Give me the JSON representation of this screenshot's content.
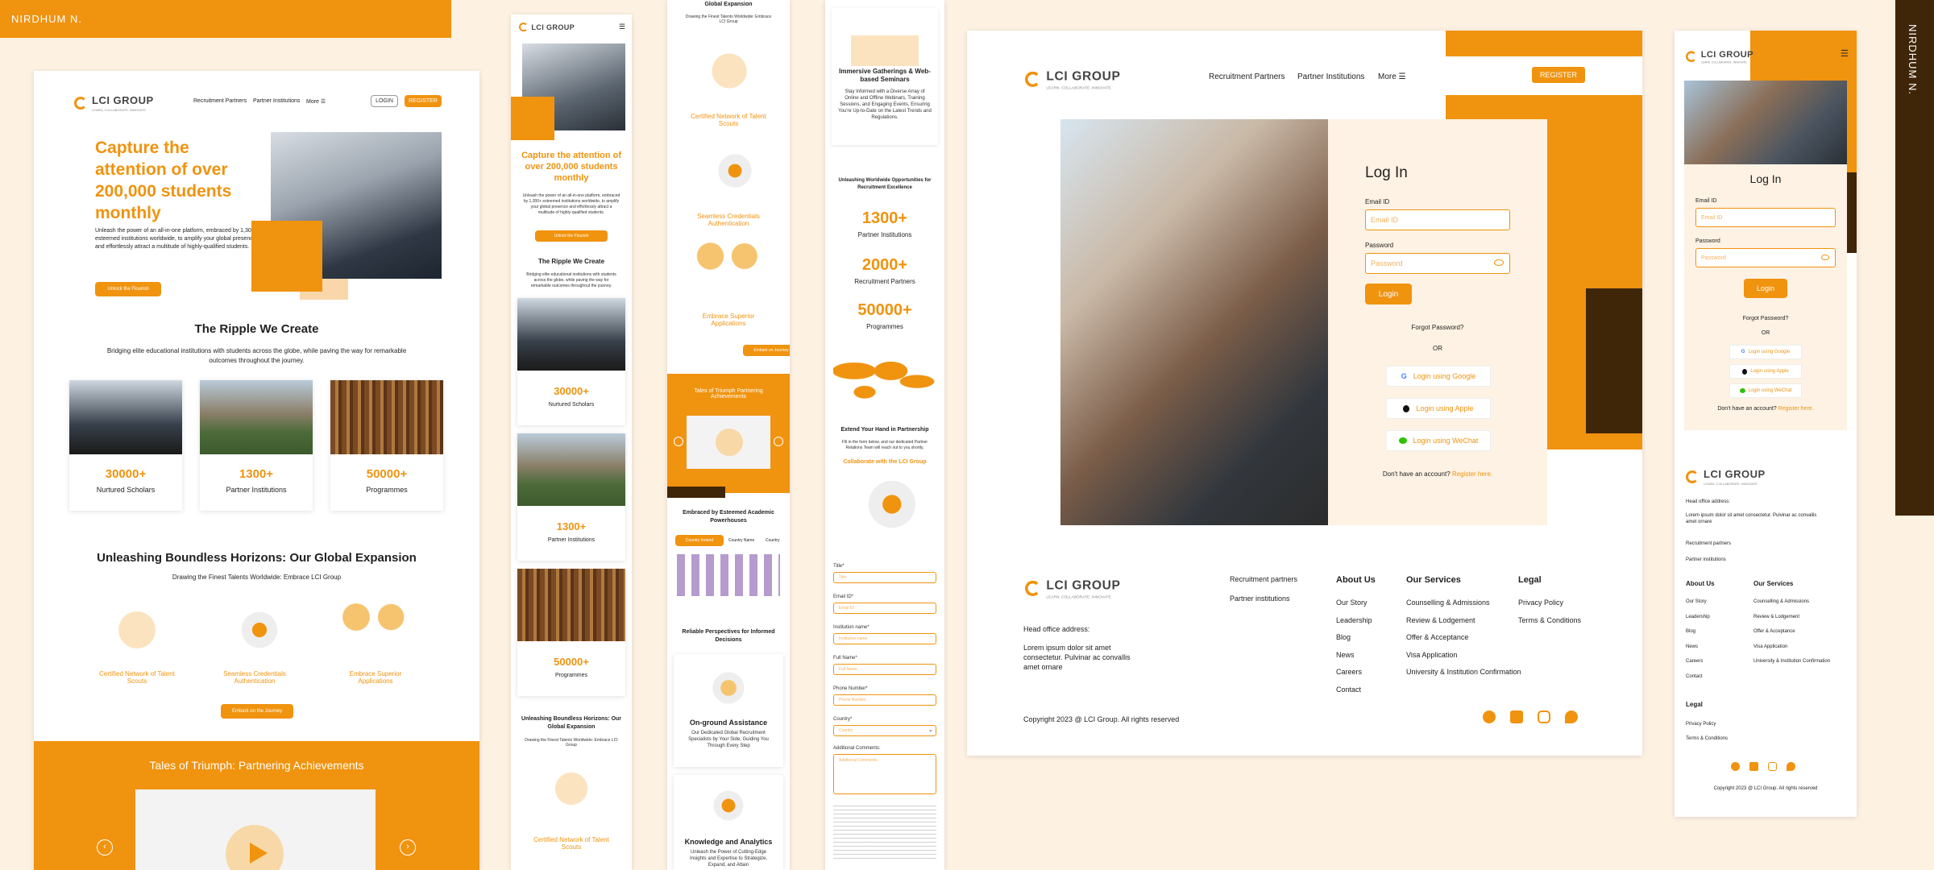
{
  "author": "NIRDHUM N.",
  "brand": {
    "name": "LCI GROUP",
    "tagline": "LEARN. COLLABORATE. INNOVATE"
  },
  "nav": {
    "recruitment": "Recruitment Partners",
    "partners": "Partner Institutions",
    "more": "More ☰",
    "login": "LOGIN",
    "register": "REGISTER"
  },
  "hero": {
    "title": "Capture the attention of over 200,000 students monthly",
    "body": "Unleash the power of an all-in-one platform, embraced by 1,300+ esteemed institutions worldwide, to amplify your global presence and effortlessly attract a multitude of highly-qualified students.",
    "cta": "Unlock the Flourish"
  },
  "ripple": {
    "title": "The Ripple We Create",
    "body": "Bridging elite educational institutions with students across the globe, while paving the way for remarkable outcomes throughout the journey."
  },
  "stats": [
    {
      "n": "30000+",
      "l": "Nurtured Scholars"
    },
    {
      "n": "1300+",
      "l": "Partner Institutions"
    },
    {
      "n": "50000+",
      "l": "Programmes"
    }
  ],
  "expansion": {
    "title": "Unleashing Boundless Horizons: Our Global Expansion",
    "body": "Drawing the Finest Talents Worldwide: Embrace LCI Group",
    "cta": "Embark on the Journey"
  },
  "features": [
    "Certified Network of Talent Scouts",
    "Seamless Credentials Authentication",
    "Embrace Superior Applications"
  ],
  "tales": "Tales of Triumph: Partnering Achievements",
  "col3": {
    "global": "Global Expansion",
    "drawing": "Drawing the Finest Talents Worldwide: Embrace LCI Group",
    "explore": "Embark on Journey",
    "tales": "Tales of Triumph Partnering Achievements",
    "embraced": "Embraced by Esteemed Academic Powerhouses",
    "tabs": [
      "Country Ireland",
      "Country Name",
      "Country"
    ],
    "perspectives": "Reliable Perspectives for Informed Decisions",
    "onground": "On-ground Assistance",
    "onground_body": "Our Dedicated Global Recruitment Specialists by Your Side, Guiding You Through Every Step",
    "knowledge": "Knowledge and Analytics",
    "knowledge_body": "Unleash the Power of Cutting-Edge Insights and Expertise to Strategize, Expand, and Attain"
  },
  "col4": {
    "immersive": "Immersive Gatherings & Web-based Seminars",
    "immersive_body": "Stay Informed with a Diverse Array of Online and Offline Webinars, Training Sessions, and Engaging Events, Ensuring You're Up-to-Date on the Latest Trends and Regulations.",
    "opps": "Unleashing Worldwide Opportunities for Recruitment Excellence",
    "stats": [
      {
        "n": "1300+",
        "l": "Partner Institutions"
      },
      {
        "n": "2000+",
        "l": "Recruitment Partners"
      },
      {
        "n": "50000+",
        "l": "Programmes"
      }
    ],
    "extend": "Extend Your Hand in Partnership",
    "extend_body": "Fill in the form below, and our dedicated Partner Relations Team will reach out to you shortly.",
    "collab": "Collaborate with the LCI Group",
    "fields": [
      "Title*",
      "Email ID*",
      "Institution name*",
      "Full Name*",
      "Phone Number*",
      "Country*"
    ],
    "placeholders": [
      "Title",
      "Email ID",
      "Institution name",
      "Full Name",
      "Phone Number",
      "Country"
    ],
    "comments": "Additional Comments:",
    "comments_ph": "Additional Comments"
  },
  "login": {
    "title": "Log In",
    "email": "Email ID",
    "email_ph": "Email ID",
    "password": "Password",
    "password_ph": "Password",
    "btn": "Login",
    "forgot": "Forgot Password?",
    "or": "OR",
    "google": "Login using Google",
    "apple": "Login using Apple",
    "wechat": "Login using WeChat",
    "noacc": "Don't have an account?",
    "register": "Register here."
  },
  "footer": {
    "office": "Head office address:",
    "address": "Lorem ipsum dolor sit amet consectetur. Pulvinar ac convallis amet ornare",
    "links": [
      "Recruitment partners",
      "Partner institutions"
    ],
    "about": "About Us",
    "about_items": [
      "Our Story",
      "Leadership",
      "Blog",
      "News",
      "Careers",
      "Contact"
    ],
    "services": "Our Services",
    "services_items": [
      "Counselling & Admissions",
      "Review & Lodgement",
      "Offer & Acceptance",
      "Visa Application",
      "University & Institution Confirmation"
    ],
    "legal": "Legal",
    "legal_items": [
      "Privacy Policy",
      "Terms & Conditions"
    ],
    "copyright": "Copyright 2023 @ LCI Group. All rights reserved"
  }
}
